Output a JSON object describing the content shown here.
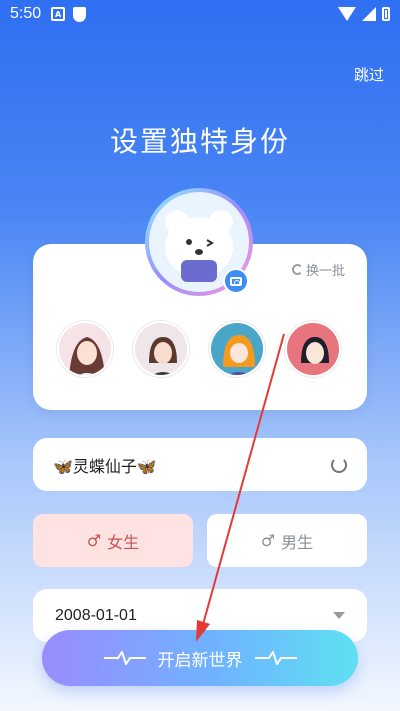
{
  "status": {
    "time": "5:50",
    "app_icon_letter": "A"
  },
  "header": {
    "skip_label": "跳过",
    "title": "设置独特身份"
  },
  "avatar_card": {
    "swap_label": "换一批"
  },
  "name": {
    "value": "🦋灵蝶仙子🦋"
  },
  "gender": {
    "female_label": "女生",
    "male_label": "男生",
    "female_symbol": "♂",
    "male_symbol": "♂",
    "selected": "female"
  },
  "birthday": {
    "value": "2008-01-01"
  },
  "start_button": {
    "label": "开启新世界"
  },
  "colors": {
    "primary": "#2f6ff2",
    "female_bg": "#ffe2e2",
    "female_text": "#c8534f",
    "arrow": "#e53935"
  },
  "icons": [
    "camera-icon",
    "swap-icon",
    "refresh-icon",
    "dropdown-icon",
    "wave-icon"
  ]
}
